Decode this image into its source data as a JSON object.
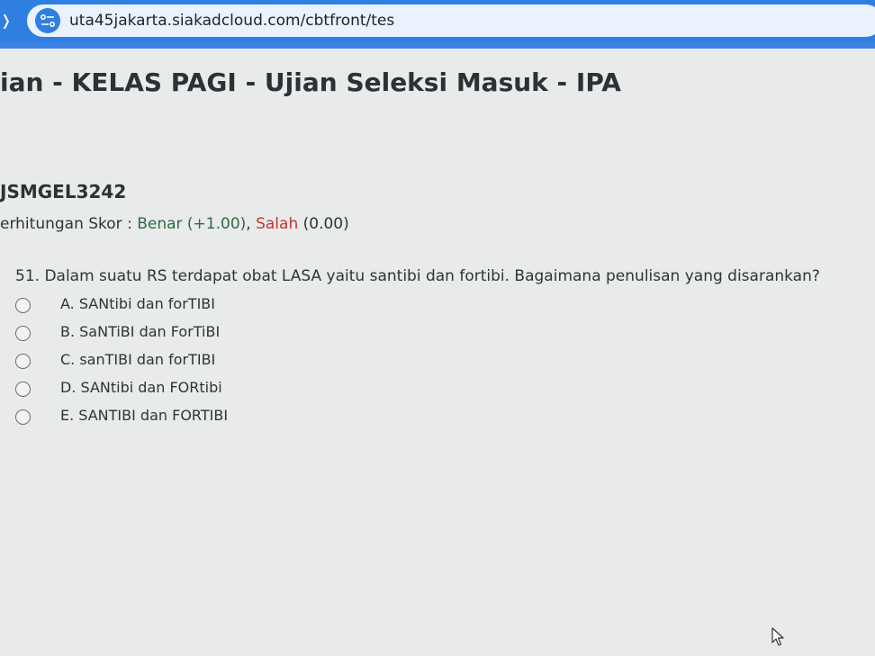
{
  "browser": {
    "url": "uta45jakarta.siakadcloud.com/cbtfront/tes"
  },
  "page": {
    "title": "ian - KELAS PAGI - Ujian Seleksi Masuk - IPA",
    "code": "JSMGEL3242",
    "score": {
      "prefix": "erhitungan Skor : ",
      "benar": "Benar (+1.00)",
      "separator": ", ",
      "salah": "Salah",
      "salah_value": " (0.00)"
    }
  },
  "question": {
    "text": "51. Dalam suatu RS terdapat obat LASA yaitu santibi dan fortibi. Bagaimana penulisan yang disarankan?",
    "options": [
      "A. SANtibi dan forTIBI",
      "B. SaNTiBI dan ForTiBI",
      "C. sanTIBI dan forTIBI",
      "D. SANtibi dan FORtibi",
      "E. SANTIBI dan FORTIBI"
    ]
  },
  "colors": {
    "topbar": "#2f7fe0",
    "benar": "#2f6a44",
    "salah": "#c0392b"
  }
}
